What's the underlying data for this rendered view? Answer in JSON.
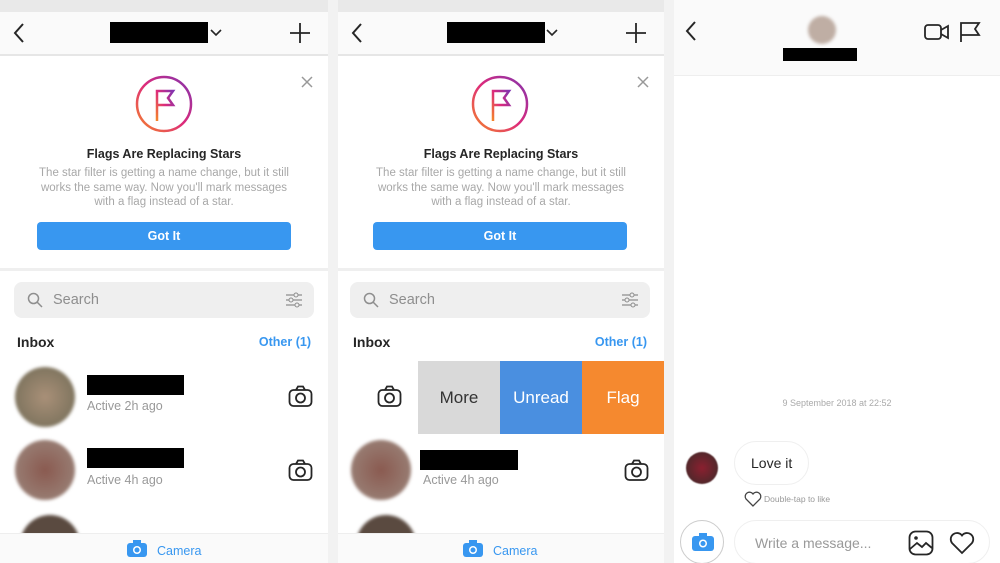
{
  "banner": {
    "title": "Flags Are Replacing Stars",
    "body": "The star filter is getting a name change, but it still works the same way. Now you'll mark messages with a flag instead of a star.",
    "button": "Got It"
  },
  "search": {
    "placeholder": "Search"
  },
  "inbox": {
    "label": "Inbox",
    "other": "Other (1)"
  },
  "threads": [
    {
      "status": "Active 2h ago"
    },
    {
      "status": "Active 4h ago"
    }
  ],
  "swipe_actions": [
    {
      "label": "More",
      "color": "#d9d9d9"
    },
    {
      "label": "Unread",
      "color": "#4a8fe0"
    },
    {
      "label": "Flag",
      "color": "#f5892f"
    }
  ],
  "bottom": {
    "camera": "Camera"
  },
  "chat": {
    "timestamp": "9 September 2018 at 22:52",
    "message": "Love it",
    "hint": "Double-tap to like",
    "input_placeholder": "Write a message..."
  },
  "colors": {
    "accent": "#3897f0"
  }
}
